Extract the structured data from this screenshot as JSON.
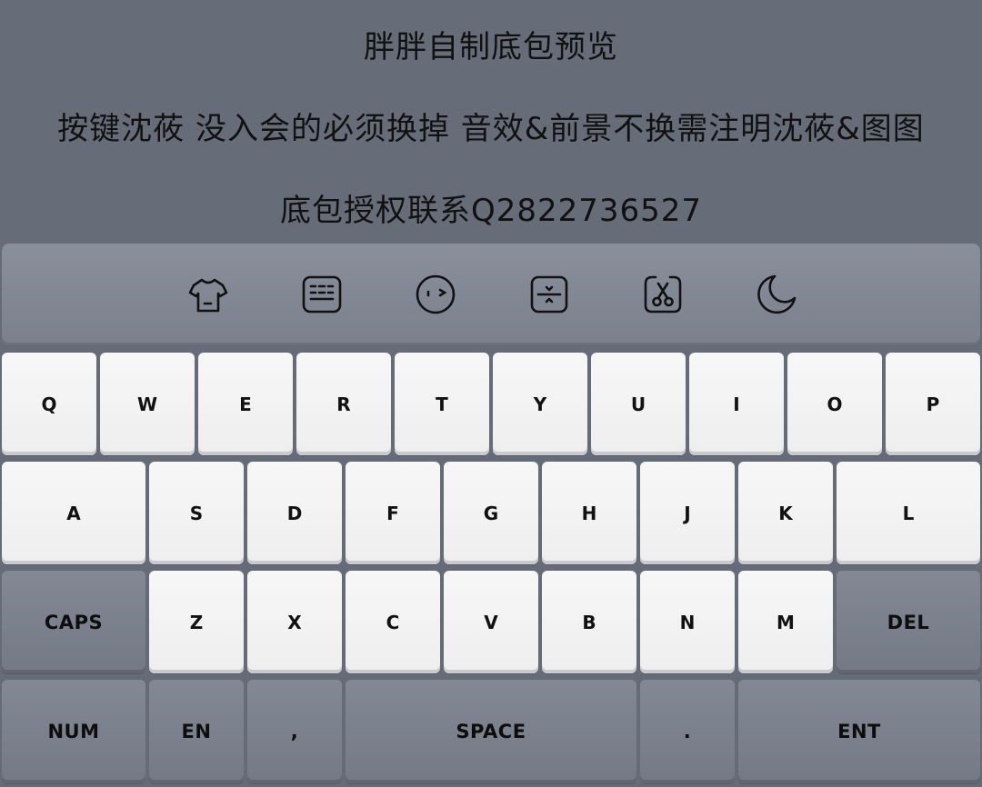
{
  "header": {
    "line1": "胖胖自制底包预览",
    "line2": "按键沈莜 没入会的必须换掉 音效&前景不换需注明沈莜&图图",
    "line3": "底包授权联系Q2822736527"
  },
  "toolbar": {
    "icons": [
      "tshirt-icon",
      "keyboard-icon",
      "emoji-icon",
      "resize-icon",
      "clipboard-icon",
      "moon-icon"
    ]
  },
  "keyboard": {
    "row1": [
      "Q",
      "W",
      "E",
      "R",
      "T",
      "Y",
      "U",
      "I",
      "O",
      "P"
    ],
    "row2": [
      "A",
      "S",
      "D",
      "F",
      "G",
      "H",
      "J",
      "K",
      "L"
    ],
    "row3": {
      "caps": "CAPS",
      "letters": [
        "Z",
        "X",
        "C",
        "V",
        "B",
        "N",
        "M"
      ],
      "del": "DEL"
    },
    "row4": {
      "num": "NUM",
      "lang": "EN",
      "comma": ",",
      "space": "SPACE",
      "period": ".",
      "enter": "ENT"
    }
  },
  "colors": {
    "background": "#666b78",
    "key_light": "#f2f2f3",
    "key_dark": "#7c818e",
    "text": "#111111"
  }
}
